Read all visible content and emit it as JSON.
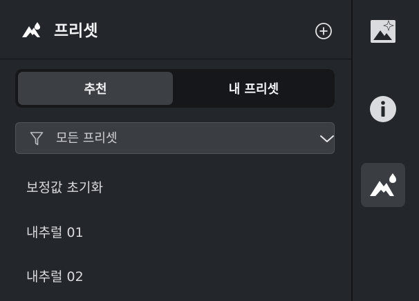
{
  "panel": {
    "title": "프리셋",
    "logo_icon": "mountain-drop-icon",
    "add_icon": "plus-circle-icon"
  },
  "tabs": [
    {
      "label": "추천",
      "active": true
    },
    {
      "label": "내 프리셋",
      "active": false
    }
  ],
  "filter": {
    "icon": "funnel-icon",
    "selected": "모든 프리셋",
    "chevron_icon": "chevron-down-icon"
  },
  "presets": [
    {
      "label": "보정값 초기화"
    },
    {
      "label": "내추럴 01"
    },
    {
      "label": "내추럴 02"
    }
  ],
  "toolbar": {
    "items": [
      {
        "icon": "ai-image-sparkle-icon",
        "active": false
      },
      {
        "icon": "info-icon",
        "active": false
      },
      {
        "icon": "mountain-drop-icon",
        "active": true
      }
    ]
  },
  "colors": {
    "background": "#23262a",
    "tab_track": "#15171a",
    "tab_active": "#3c4045",
    "filter_bg": "#3a3e43",
    "text_primary": "#f2f3f5"
  }
}
